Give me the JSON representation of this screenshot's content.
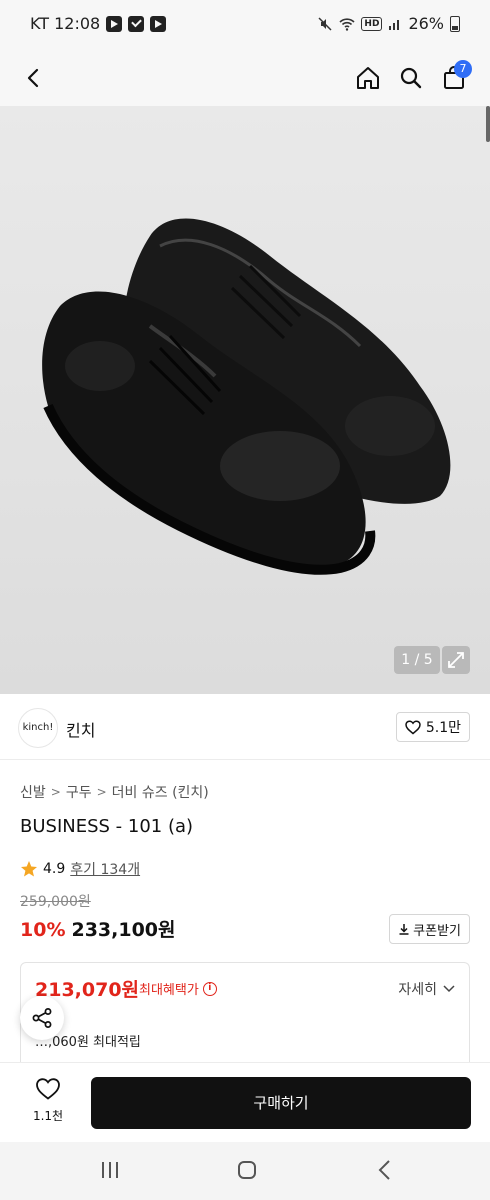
{
  "status_bar": {
    "carrier_time": "KT 12:08",
    "battery": "26%"
  },
  "header": {
    "cart_count": "7",
    "icons": [
      "back-icon",
      "home-icon",
      "search-icon",
      "shopping-bag-icon"
    ]
  },
  "gallery": {
    "indicator": "1 / 5",
    "current_page": 1,
    "total_pages": 5
  },
  "brand": {
    "logo_text": "kinch!",
    "name": "킨치",
    "likes": "5.1만"
  },
  "breadcrumb": [
    "신발",
    "구두",
    "더비 슈즈 (킨치)"
  ],
  "product": {
    "title": "BUSINESS - 101 (a)",
    "rating": "4.9",
    "reviews": "후기 134개",
    "original_price": "259,000원",
    "discount": "10%",
    "sale_price": "233,100원",
    "coupon_label": "쿠폰받기"
  },
  "benefit": {
    "best_price": "213,070원",
    "best_label": "최대혜택가",
    "detail_label": "자세히",
    "points": "…,060원 최대적립"
  },
  "action_bar": {
    "wish_count": "1.1천",
    "buy_label": "구매하기"
  },
  "colors": {
    "accent_red": "#e1251b",
    "badge_blue": "#2f6df6",
    "buy_button": "#111111"
  }
}
